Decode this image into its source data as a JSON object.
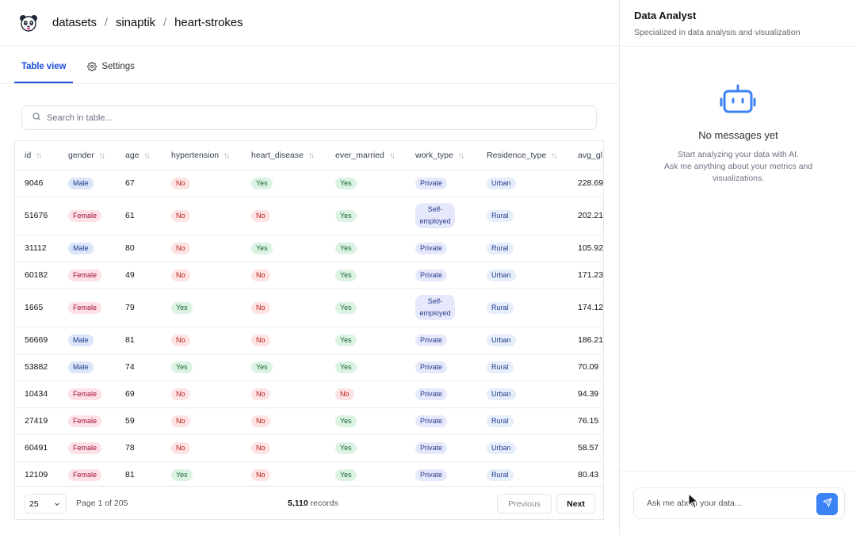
{
  "breadcrumb": {
    "items": [
      "datasets",
      "sinaptik",
      "heart-strokes"
    ],
    "separator": "/"
  },
  "tabs": [
    {
      "label": "Table view",
      "icon": "",
      "active": true
    },
    {
      "label": "Settings",
      "icon": "gear-icon",
      "active": false
    }
  ],
  "search": {
    "placeholder": "Search in table..."
  },
  "table": {
    "columns": [
      "id",
      "gender",
      "age",
      "hypertension",
      "heart_disease",
      "ever_married",
      "work_type",
      "Residence_type",
      "avg_gl"
    ],
    "rows": [
      {
        "id": "9046",
        "gender": "Male",
        "age": "67",
        "hypertension": "No",
        "heart_disease": "Yes",
        "ever_married": "Yes",
        "work_type": "Private",
        "residence": "Urban",
        "avg": "228.69"
      },
      {
        "id": "51676",
        "gender": "Female",
        "age": "61",
        "hypertension": "No",
        "heart_disease": "No",
        "ever_married": "Yes",
        "work_type": "Self-employed",
        "residence": "Rural",
        "avg": "202.21"
      },
      {
        "id": "31112",
        "gender": "Male",
        "age": "80",
        "hypertension": "No",
        "heart_disease": "Yes",
        "ever_married": "Yes",
        "work_type": "Private",
        "residence": "Rural",
        "avg": "105.92"
      },
      {
        "id": "60182",
        "gender": "Female",
        "age": "49",
        "hypertension": "No",
        "heart_disease": "No",
        "ever_married": "Yes",
        "work_type": "Private",
        "residence": "Urban",
        "avg": "171.23"
      },
      {
        "id": "1665",
        "gender": "Female",
        "age": "79",
        "hypertension": "Yes",
        "heart_disease": "No",
        "ever_married": "Yes",
        "work_type": "Self-employed",
        "residence": "Rural",
        "avg": "174.12"
      },
      {
        "id": "56669",
        "gender": "Male",
        "age": "81",
        "hypertension": "No",
        "heart_disease": "No",
        "ever_married": "Yes",
        "work_type": "Private",
        "residence": "Urban",
        "avg": "186.21"
      },
      {
        "id": "53882",
        "gender": "Male",
        "age": "74",
        "hypertension": "Yes",
        "heart_disease": "Yes",
        "ever_married": "Yes",
        "work_type": "Private",
        "residence": "Rural",
        "avg": "70.09"
      },
      {
        "id": "10434",
        "gender": "Female",
        "age": "69",
        "hypertension": "No",
        "heart_disease": "No",
        "ever_married": "No",
        "work_type": "Private",
        "residence": "Urban",
        "avg": "94.39"
      },
      {
        "id": "27419",
        "gender": "Female",
        "age": "59",
        "hypertension": "No",
        "heart_disease": "No",
        "ever_married": "Yes",
        "work_type": "Private",
        "residence": "Rural",
        "avg": "76.15"
      },
      {
        "id": "60491",
        "gender": "Female",
        "age": "78",
        "hypertension": "No",
        "heart_disease": "No",
        "ever_married": "Yes",
        "work_type": "Private",
        "residence": "Urban",
        "avg": "58.57"
      },
      {
        "id": "12109",
        "gender": "Female",
        "age": "81",
        "hypertension": "Yes",
        "heart_disease": "No",
        "ever_married": "Yes",
        "work_type": "Private",
        "residence": "Rural",
        "avg": "80.43"
      }
    ]
  },
  "pagination": {
    "page_size": "25",
    "page_info": "Page 1 of 205",
    "record_count": "5,110",
    "records_label": "records",
    "prev_label": "Previous",
    "next_label": "Next"
  },
  "panel": {
    "title": "Data Analyst",
    "subtitle": "Specialized in data analysis and visualization",
    "empty_title": "No messages yet",
    "empty_line1": "Start analyzing your data with AI.",
    "empty_line2": "Ask me anything about your metrics and visualizations.",
    "input_placeholder": "Ask me about your data..."
  },
  "colors": {
    "accent": "#1d4ed8",
    "send_button": "#3b82f6"
  }
}
